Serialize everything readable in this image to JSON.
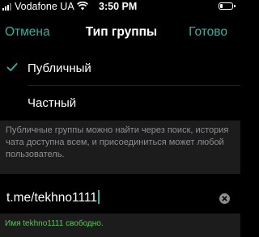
{
  "status_bar": {
    "carrier": "Vodafone UA",
    "time": "3:50 PM",
    "battery_level": 0.2
  },
  "nav": {
    "cancel": "Отмена",
    "title": "Тип группы",
    "done": "Готово"
  },
  "options": [
    {
      "label": "Публичный",
      "selected": true
    },
    {
      "label": "Частный",
      "selected": false
    }
  ],
  "info_text": "Публичные группы можно найти через поиск, история чата доступна всем, и присоединиться может любой пользователь.",
  "link_input": {
    "value": "t.me/tekhno1111"
  },
  "availability_message": "Имя tekhno1111 свободно.",
  "colors": {
    "accent": "#2fb3a0",
    "success": "#5ac35c",
    "background": "#000000",
    "panel": "#1c1c1d",
    "secondary_text": "#8e8e93"
  }
}
